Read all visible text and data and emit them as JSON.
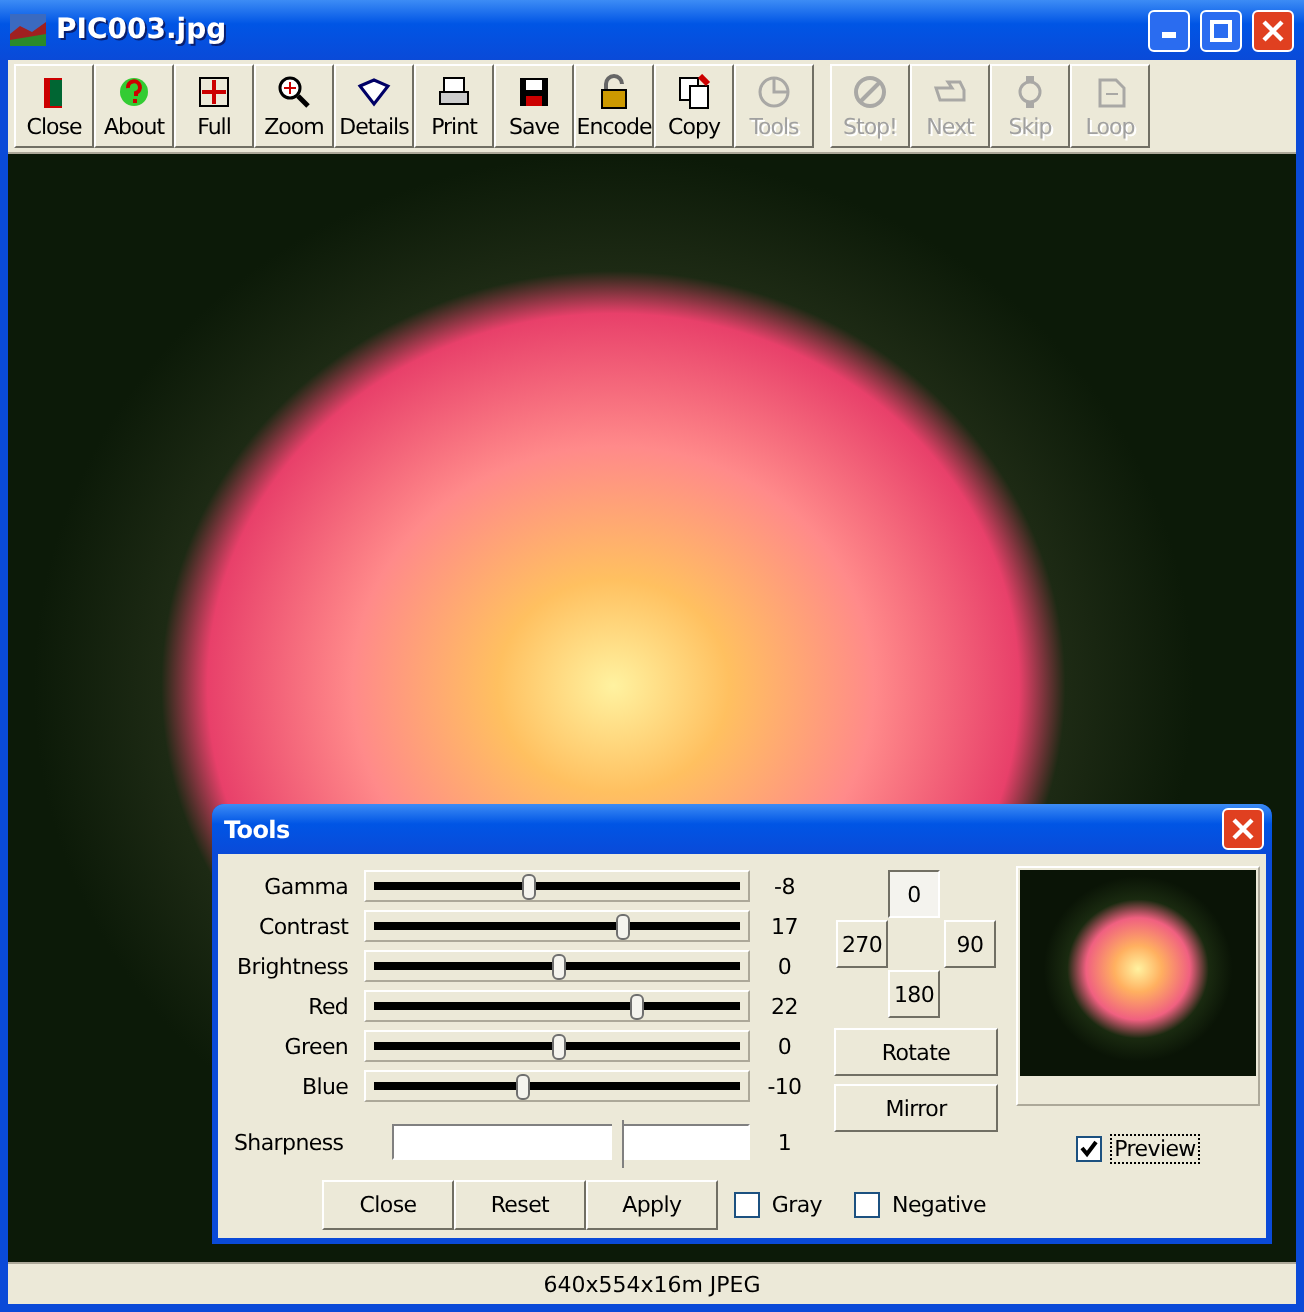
{
  "window": {
    "title": "PIC003.jpg"
  },
  "toolbar": [
    {
      "label": "Close",
      "disabled": false
    },
    {
      "label": "About",
      "disabled": false
    },
    {
      "label": "Full",
      "disabled": false
    },
    {
      "label": "Zoom",
      "disabled": false
    },
    {
      "label": "Details",
      "disabled": false
    },
    {
      "label": "Print",
      "disabled": false
    },
    {
      "label": "Save",
      "disabled": false
    },
    {
      "label": "Encode",
      "disabled": false
    },
    {
      "label": "Copy",
      "disabled": false
    },
    {
      "label": "Tools",
      "disabled": true
    },
    {
      "label": "Stop!",
      "disabled": true
    },
    {
      "label": "Next",
      "disabled": true
    },
    {
      "label": "Skip",
      "disabled": true
    },
    {
      "label": "Loop",
      "disabled": true
    }
  ],
  "tools_dialog": {
    "title": "Tools",
    "sliders": [
      {
        "name": "Gamma",
        "level": 0.42,
        "reading": "-8"
      },
      {
        "name": "Contrast",
        "level": 0.67,
        "reading": "17"
      },
      {
        "name": "Brightness",
        "level": 0.5,
        "reading": "0"
      },
      {
        "name": "Red",
        "level": 0.71,
        "reading": "22"
      },
      {
        "name": "Green",
        "level": 0.5,
        "reading": "0"
      },
      {
        "name": "Blue",
        "level": 0.4,
        "reading": "-10"
      }
    ],
    "sharpness": {
      "name": "Sharpness",
      "level": 0.62,
      "reading": "1"
    },
    "rotation": [
      {
        "label": "0",
        "selected": true
      },
      {
        "label": "270",
        "selected": false
      },
      {
        "label": "90",
        "selected": false
      },
      {
        "label": "180",
        "selected": false
      }
    ],
    "rotate_button": "Rotate",
    "mirror_button": "Mirror",
    "preview": {
      "label": "Preview",
      "checked": true
    },
    "buttons": [
      "Close",
      "Reset",
      "Apply"
    ],
    "options": [
      {
        "label": "Gray",
        "checked": false
      },
      {
        "label": "Negative",
        "checked": false
      }
    ]
  },
  "status_bar": "640x554x16m JPEG"
}
